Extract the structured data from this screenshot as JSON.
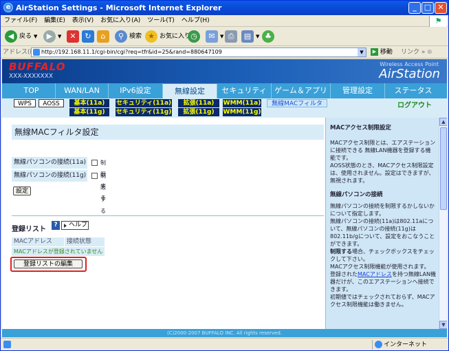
{
  "window": {
    "title": "AirStation Settings - Microsoft Internet Explorer"
  },
  "menu": [
    "ファイル(F)",
    "編集(E)",
    "表示(V)",
    "お気に入り(A)",
    "ツール(T)",
    "ヘルプ(H)"
  ],
  "toolbar": {
    "back": "戻る",
    "search": "検索",
    "favorites": "お気に入り"
  },
  "address": {
    "label": "アドレス(D)",
    "url": "http://192.168.11.1/cgi-bin/cgi?req=tfr&id=25&rand=880647109",
    "go": "移動",
    "links": "リンク"
  },
  "header": {
    "logo": "BUFFALO",
    "model": "XXX-XXXXXXX",
    "wap": "Wireless Access Point",
    "product": "AirStation"
  },
  "nav": [
    "TOP",
    "WAN/LAN",
    "IPv6設定",
    "無線設定",
    "セキュリティ",
    "ゲーム＆アプリ",
    "管理設定",
    "ステータス"
  ],
  "subnav": {
    "wps": "WPS",
    "aoss": "AOSS",
    "basic_a": "基本(11a)",
    "basic_g": "基本(11g)",
    "sec_a": "セキュリティ(11a)",
    "sec_g": "セキュリティ(11g)",
    "ext_a": "拡張(11a)",
    "ext_g": "拡張(11g)",
    "wmm_a": "WMM(11a)",
    "wmm_g": "WMM(11g)",
    "mac": "無線MACフィルタ",
    "logout": "ログアウト"
  },
  "main": {
    "title": "無線MACフィルタ設定",
    "row1": "無線パソコンの接続(11a)",
    "row2": "無線パソコンの接続(11g)",
    "enable": "制限する",
    "set": "設定",
    "reglist": "登録リスト",
    "help": "ヘルプ",
    "col_mac": "MACアドレス",
    "col_status": "接続状態",
    "empty": "MACアドレスが登録されていません",
    "edit": "登録リストの編集"
  },
  "footer": "(C)2000-2007 BUFFALO INC. All rights reserved.",
  "side": {
    "h1": "MACアクセス制限設定",
    "p1": "MACアクセス制限とは、エアステーションに接続できる 無線LAN機器を登録する機能です。",
    "p2": "AOSS状態のとき、MACアクセス制限設定は、使用されません。設定はできますが、無視されます。",
    "h2": "無線パソコンの接続",
    "p3": "無線パソコンの接続を制限するかしないかについて指定します。",
    "p4": "無線パソコンの接続(11a)は802.11aについて、無線パソコンの接続(11g)は802.11b/gについて、設定をおこなうことができます。",
    "p5b": "制限する",
    "p5": "場合、チェックボックスをチェックして下さい。",
    "p6": "MACアクセス制限機能が使用されます。",
    "p7a": "登録された",
    "p7link": "MACアドレス",
    "p7b": "を持つ無線LAN機器だけが、このエアステーションへ接続できます。",
    "p8": "初期値ではチェックされておらず、MACアクセス制限機能は働きません。"
  },
  "status": {
    "zone": "インターネット"
  }
}
